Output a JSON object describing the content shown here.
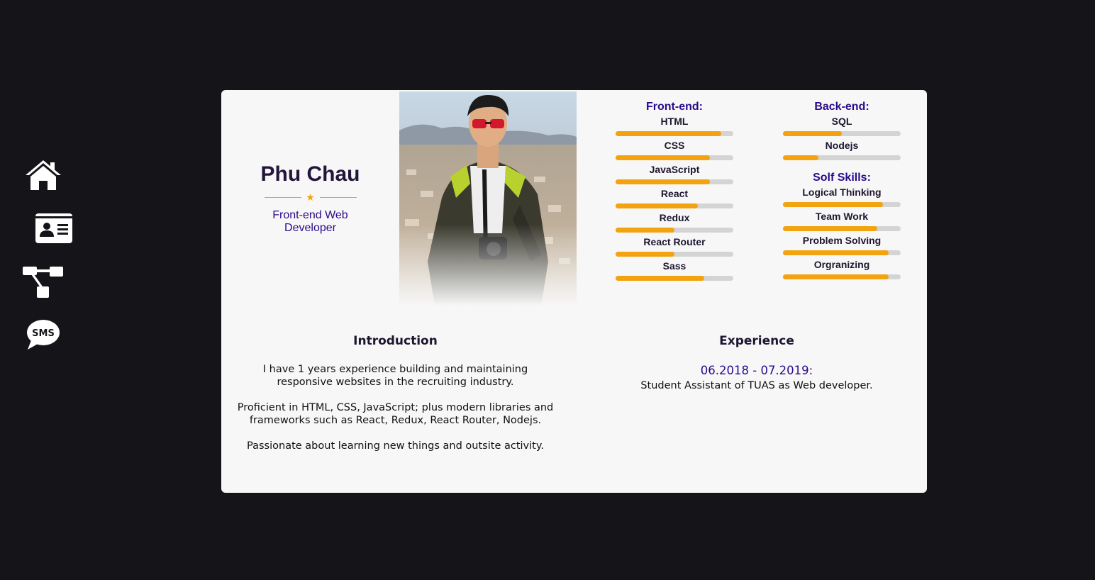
{
  "nav": [
    {
      "icon": "home-icon"
    },
    {
      "icon": "id-card-icon"
    },
    {
      "icon": "sitemap-icon"
    },
    {
      "icon": "sms-icon",
      "label": "SMS"
    }
  ],
  "profile": {
    "name": "Phu Chau",
    "job_title": "Front-end Web Developer",
    "divider_icon": "star-icon"
  },
  "skills": {
    "frontend_heading": "Front-end:",
    "frontend": [
      {
        "label": "HTML",
        "level": 0.9
      },
      {
        "label": "CSS",
        "level": 0.8
      },
      {
        "label": "JavaScript",
        "level": 0.8
      },
      {
        "label": "React",
        "level": 0.7
      },
      {
        "label": "Redux",
        "level": 0.5
      },
      {
        "label": "React Router",
        "level": 0.5
      },
      {
        "label": "Sass",
        "level": 0.75
      }
    ],
    "backend_heading": "Back-end:",
    "backend": [
      {
        "label": "SQL",
        "level": 0.5
      },
      {
        "label": "Nodejs",
        "level": 0.3
      }
    ],
    "soft_heading": "Solf Skills:",
    "soft": [
      {
        "label": "Logical Thinking",
        "level": 0.85
      },
      {
        "label": "Team Work",
        "level": 0.8
      },
      {
        "label": "Problem Solving",
        "level": 0.9
      },
      {
        "label": "Orgranizing",
        "level": 0.9
      }
    ]
  },
  "introduction": {
    "title": "Introduction",
    "paragraphs": [
      "I have 1 years experience building and maintaining responsive websites in the recruiting industry.",
      "Proficient in HTML, CSS, JavaScript; plus modern libraries and frameworks such as React, Redux, React Router, Nodejs.",
      "Passionate about learning new things and outsite activity."
    ]
  },
  "experience": {
    "title": "Experience",
    "date": "06.2018 - 07.2019:",
    "description": "Student Assistant of TUAS as Web developer."
  },
  "colors": {
    "background": "#151418",
    "card": "#f7f7f7",
    "accent": "#f2a30f",
    "heading": "#2a0a8a",
    "bar_track": "#d4d4d4"
  }
}
